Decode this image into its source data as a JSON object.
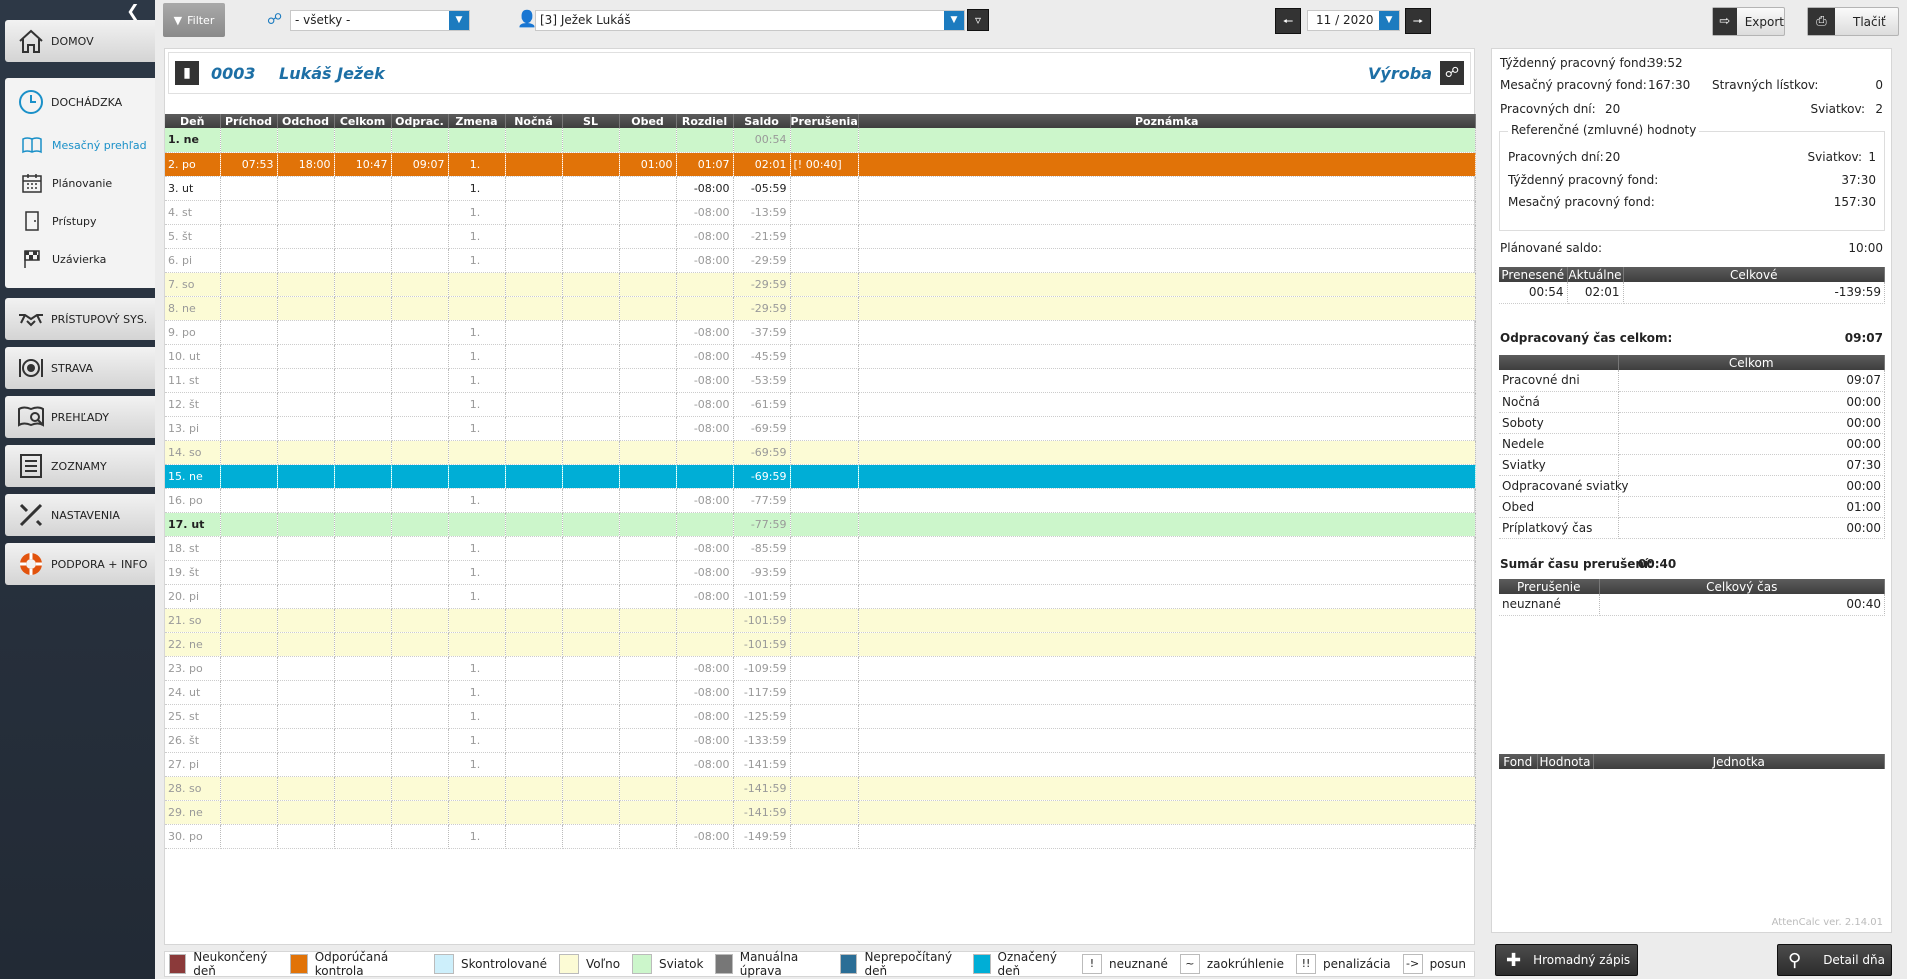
{
  "sidebar": {
    "items": [
      {
        "label": "DOMOV"
      },
      {
        "label": "DOCHÁDZKA"
      },
      {
        "label": "PRÍSTUPOVÝ SYS."
      },
      {
        "label": "STRAVA"
      },
      {
        "label": "PREHĽADY"
      },
      {
        "label": "ZOZNAMY"
      },
      {
        "label": "NASTAVENIA"
      },
      {
        "label": "PODPORA + INFO"
      }
    ],
    "sub": [
      {
        "label": "Mesačný prehľad"
      },
      {
        "label": "Plánovanie"
      },
      {
        "label": "Prístupy"
      },
      {
        "label": "Uzávierka"
      }
    ]
  },
  "toolbar": {
    "filter_label": "Filter",
    "group_value": "- všetky -",
    "employee_value": "[3] Ježek Lukáš",
    "month_value": "11 / 2020",
    "export_label": "Export",
    "print_label": "Tlačiť"
  },
  "employee": {
    "code": "0003",
    "name": "Lukáš Ježek",
    "department": "Výroba"
  },
  "table": {
    "headers": [
      "Deň",
      "Príchod",
      "Odchod",
      "Celkom",
      "Odprac.",
      "Zmena",
      "Nočná",
      "SL",
      "Obed",
      "Rozdiel",
      "Saldo",
      "Prerušenia",
      "Poznámka"
    ],
    "rows": [
      {
        "type": "hol",
        "day": "1. ne",
        "prichod": "",
        "odchod": "",
        "celkom": "",
        "odprac": "",
        "zmena": "",
        "nocna": "",
        "sl": "",
        "obed": "",
        "rozdiel": "",
        "saldo": "00:54",
        "prerusenia": "",
        "poznamka": ""
      },
      {
        "type": "ctrl",
        "day": "2. po",
        "prichod": "07:53",
        "odchod": "18:00",
        "celkom": "10:47",
        "odprac": "09:07",
        "zmena": "1.",
        "nocna": "",
        "sl": "",
        "obed": "01:00",
        "rozdiel": "01:07",
        "saldo": "02:01",
        "prerusenia": "[! 00:40]",
        "poznamka": ""
      },
      {
        "type": "today",
        "day": "3. ut",
        "prichod": "",
        "odchod": "",
        "celkom": "",
        "odprac": "",
        "zmena": "1.",
        "nocna": "",
        "sl": "",
        "obed": "",
        "rozdiel": "-08:00",
        "saldo": "-05:59",
        "prerusenia": "",
        "poznamka": ""
      },
      {
        "type": "",
        "day": "4. st",
        "prichod": "",
        "odchod": "",
        "celkom": "",
        "odprac": "",
        "zmena": "1.",
        "nocna": "",
        "sl": "",
        "obed": "",
        "rozdiel": "-08:00",
        "saldo": "-13:59",
        "prerusenia": "",
        "poznamka": ""
      },
      {
        "type": "",
        "day": "5. št",
        "prichod": "",
        "odchod": "",
        "celkom": "",
        "odprac": "",
        "zmena": "1.",
        "nocna": "",
        "sl": "",
        "obed": "",
        "rozdiel": "-08:00",
        "saldo": "-21:59",
        "prerusenia": "",
        "poznamka": ""
      },
      {
        "type": "",
        "day": "6. pi",
        "prichod": "",
        "odchod": "",
        "celkom": "",
        "odprac": "",
        "zmena": "1.",
        "nocna": "",
        "sl": "",
        "obed": "",
        "rozdiel": "-08:00",
        "saldo": "-29:59",
        "prerusenia": "",
        "poznamka": ""
      },
      {
        "type": "we",
        "day": "7. so",
        "prichod": "",
        "odchod": "",
        "celkom": "",
        "odprac": "",
        "zmena": "",
        "nocna": "",
        "sl": "",
        "obed": "",
        "rozdiel": "",
        "saldo": "-29:59",
        "prerusenia": "",
        "poznamka": ""
      },
      {
        "type": "we",
        "day": "8. ne",
        "prichod": "",
        "odchod": "",
        "celkom": "",
        "odprac": "",
        "zmena": "",
        "nocna": "",
        "sl": "",
        "obed": "",
        "rozdiel": "",
        "saldo": "-29:59",
        "prerusenia": "",
        "poznamka": ""
      },
      {
        "type": "",
        "day": "9. po",
        "prichod": "",
        "odchod": "",
        "celkom": "",
        "odprac": "",
        "zmena": "1.",
        "nocna": "",
        "sl": "",
        "obed": "",
        "rozdiel": "-08:00",
        "saldo": "-37:59",
        "prerusenia": "",
        "poznamka": ""
      },
      {
        "type": "",
        "day": "10. ut",
        "prichod": "",
        "odchod": "",
        "celkom": "",
        "odprac": "",
        "zmena": "1.",
        "nocna": "",
        "sl": "",
        "obed": "",
        "rozdiel": "-08:00",
        "saldo": "-45:59",
        "prerusenia": "",
        "poznamka": ""
      },
      {
        "type": "",
        "day": "11. st",
        "prichod": "",
        "odchod": "",
        "celkom": "",
        "odprac": "",
        "zmena": "1.",
        "nocna": "",
        "sl": "",
        "obed": "",
        "rozdiel": "-08:00",
        "saldo": "-53:59",
        "prerusenia": "",
        "poznamka": ""
      },
      {
        "type": "",
        "day": "12. št",
        "prichod": "",
        "odchod": "",
        "celkom": "",
        "odprac": "",
        "zmena": "1.",
        "nocna": "",
        "sl": "",
        "obed": "",
        "rozdiel": "-08:00",
        "saldo": "-61:59",
        "prerusenia": "",
        "poznamka": ""
      },
      {
        "type": "",
        "day": "13. pi",
        "prichod": "",
        "odchod": "",
        "celkom": "",
        "odprac": "",
        "zmena": "1.",
        "nocna": "",
        "sl": "",
        "obed": "",
        "rozdiel": "-08:00",
        "saldo": "-69:59",
        "prerusenia": "",
        "poznamka": ""
      },
      {
        "type": "we",
        "day": "14. so",
        "prichod": "",
        "odchod": "",
        "celkom": "",
        "odprac": "",
        "zmena": "",
        "nocna": "",
        "sl": "",
        "obed": "",
        "rozdiel": "",
        "saldo": "-69:59",
        "prerusenia": "",
        "poznamka": ""
      },
      {
        "type": "mark",
        "day": "15. ne",
        "prichod": "",
        "odchod": "",
        "celkom": "",
        "odprac": "",
        "zmena": "",
        "nocna": "",
        "sl": "",
        "obed": "",
        "rozdiel": "",
        "saldo": "-69:59",
        "prerusenia": "",
        "poznamka": ""
      },
      {
        "type": "",
        "day": "16. po",
        "prichod": "",
        "odchod": "",
        "celkom": "",
        "odprac": "",
        "zmena": "1.",
        "nocna": "",
        "sl": "",
        "obed": "",
        "rozdiel": "-08:00",
        "saldo": "-77:59",
        "prerusenia": "",
        "poznamka": ""
      },
      {
        "type": "hol",
        "day": "17. ut",
        "prichod": "",
        "odchod": "",
        "celkom": "",
        "odprac": "",
        "zmena": "",
        "nocna": "",
        "sl": "",
        "obed": "",
        "rozdiel": "",
        "saldo": "-77:59",
        "prerusenia": "",
        "poznamka": ""
      },
      {
        "type": "",
        "day": "18. st",
        "prichod": "",
        "odchod": "",
        "celkom": "",
        "odprac": "",
        "zmena": "1.",
        "nocna": "",
        "sl": "",
        "obed": "",
        "rozdiel": "-08:00",
        "saldo": "-85:59",
        "prerusenia": "",
        "poznamka": ""
      },
      {
        "type": "",
        "day": "19. št",
        "prichod": "",
        "odchod": "",
        "celkom": "",
        "odprac": "",
        "zmena": "1.",
        "nocna": "",
        "sl": "",
        "obed": "",
        "rozdiel": "-08:00",
        "saldo": "-93:59",
        "prerusenia": "",
        "poznamka": ""
      },
      {
        "type": "",
        "day": "20. pi",
        "prichod": "",
        "odchod": "",
        "celkom": "",
        "odprac": "",
        "zmena": "1.",
        "nocna": "",
        "sl": "",
        "obed": "",
        "rozdiel": "-08:00",
        "saldo": "-101:59",
        "prerusenia": "",
        "poznamka": ""
      },
      {
        "type": "we",
        "day": "21. so",
        "prichod": "",
        "odchod": "",
        "celkom": "",
        "odprac": "",
        "zmena": "",
        "nocna": "",
        "sl": "",
        "obed": "",
        "rozdiel": "",
        "saldo": "-101:59",
        "prerusenia": "",
        "poznamka": ""
      },
      {
        "type": "we",
        "day": "22. ne",
        "prichod": "",
        "odchod": "",
        "celkom": "",
        "odprac": "",
        "zmena": "",
        "nocna": "",
        "sl": "",
        "obed": "",
        "rozdiel": "",
        "saldo": "-101:59",
        "prerusenia": "",
        "poznamka": ""
      },
      {
        "type": "",
        "day": "23. po",
        "prichod": "",
        "odchod": "",
        "celkom": "",
        "odprac": "",
        "zmena": "1.",
        "nocna": "",
        "sl": "",
        "obed": "",
        "rozdiel": "-08:00",
        "saldo": "-109:59",
        "prerusenia": "",
        "poznamka": ""
      },
      {
        "type": "",
        "day": "24. ut",
        "prichod": "",
        "odchod": "",
        "celkom": "",
        "odprac": "",
        "zmena": "1.",
        "nocna": "",
        "sl": "",
        "obed": "",
        "rozdiel": "-08:00",
        "saldo": "-117:59",
        "prerusenia": "",
        "poznamka": ""
      },
      {
        "type": "",
        "day": "25. st",
        "prichod": "",
        "odchod": "",
        "celkom": "",
        "odprac": "",
        "zmena": "1.",
        "nocna": "",
        "sl": "",
        "obed": "",
        "rozdiel": "-08:00",
        "saldo": "-125:59",
        "prerusenia": "",
        "poznamka": ""
      },
      {
        "type": "",
        "day": "26. št",
        "prichod": "",
        "odchod": "",
        "celkom": "",
        "odprac": "",
        "zmena": "1.",
        "nocna": "",
        "sl": "",
        "obed": "",
        "rozdiel": "-08:00",
        "saldo": "-133:59",
        "prerusenia": "",
        "poznamka": ""
      },
      {
        "type": "",
        "day": "27. pi",
        "prichod": "",
        "odchod": "",
        "celkom": "",
        "odprac": "",
        "zmena": "1.",
        "nocna": "",
        "sl": "",
        "obed": "",
        "rozdiel": "-08:00",
        "saldo": "-141:59",
        "prerusenia": "",
        "poznamka": ""
      },
      {
        "type": "we",
        "day": "28. so",
        "prichod": "",
        "odchod": "",
        "celkom": "",
        "odprac": "",
        "zmena": "",
        "nocna": "",
        "sl": "",
        "obed": "",
        "rozdiel": "",
        "saldo": "-141:59",
        "prerusenia": "",
        "poznamka": ""
      },
      {
        "type": "we",
        "day": "29. ne",
        "prichod": "",
        "odchod": "",
        "celkom": "",
        "odprac": "",
        "zmena": "",
        "nocna": "",
        "sl": "",
        "obed": "",
        "rozdiel": "",
        "saldo": "-141:59",
        "prerusenia": "",
        "poznamka": ""
      },
      {
        "type": "",
        "day": "30. po",
        "prichod": "",
        "odchod": "",
        "celkom": "",
        "odprac": "",
        "zmena": "1.",
        "nocna": "",
        "sl": "",
        "obed": "",
        "rozdiel": "-08:00",
        "saldo": "-149:59",
        "prerusenia": "",
        "poznamka": ""
      }
    ]
  },
  "summary": {
    "weekly_fund_label": "Týždenný pracovný fond:",
    "weekly_fund": "39:52",
    "monthly_fund_label": "Mesačný pracovný fond:",
    "monthly_fund": "167:30",
    "meal_label": "Stravných lístkov:",
    "meal": "0",
    "workdays_label": "Pracovných dní:",
    "workdays": "20",
    "holidays_label": "Sviatkov:",
    "holidays": "2",
    "ref": {
      "title": "Referenčné (zmluvné) hodnoty",
      "workdays_label": "Pracovných dní:",
      "workdays": "20",
      "holidays_label": "Sviatkov:",
      "holidays": "1",
      "weekly_label": "Týždenný pracovný fond:",
      "weekly": "37:30",
      "monthly_label": "Mesačný pracovný fond:",
      "monthly": "157:30"
    },
    "planned_label": "Plánované saldo:",
    "planned": "10:00",
    "saldo_headers": [
      "Prenesené",
      "Aktuálne",
      "Celkové"
    ],
    "saldo_values": [
      "00:54",
      "02:01",
      "-139:59"
    ],
    "worked_label": "Odpracovaný čas celkom:",
    "worked": "09:07",
    "worked_header": "Celkom",
    "worked_rows": [
      {
        "label": "Pracovné dni",
        "value": "09:07"
      },
      {
        "label": "Nočná",
        "value": "00:00"
      },
      {
        "label": "Soboty",
        "value": "00:00"
      },
      {
        "label": "Nedele",
        "value": "00:00"
      },
      {
        "label": "Sviatky",
        "value": "07:30"
      },
      {
        "label": "Odpracované sviatky",
        "value": "00:00"
      },
      {
        "label": "Obed",
        "value": "01:00"
      },
      {
        "label": "Príplatkový čas",
        "value": "00:00"
      }
    ],
    "break_label": "Sumár času prerušení:",
    "break": "00:40",
    "break_headers": [
      "Prerušenie",
      "Celkový čas"
    ],
    "break_rows": [
      {
        "label": "neuznané",
        "value": "00:40"
      }
    ],
    "fund_headers": [
      "Fond",
      "Hodnota",
      "Jednotka"
    ],
    "version": "AttenCalc ver. 2.14.01"
  },
  "legend": [
    {
      "label": "Neukončený deň",
      "color": "#8b3a3a",
      "mark": ""
    },
    {
      "label": "Odporúčaná kontrola",
      "color": "#e17308",
      "mark": ""
    },
    {
      "label": "Skontrolované",
      "color": "#cdeffb",
      "mark": ""
    },
    {
      "label": "Voľno",
      "color": "#fcfbd5",
      "mark": ""
    },
    {
      "label": "Sviatok",
      "color": "#ccf6cb",
      "mark": ""
    },
    {
      "label": "Manuálna úprava",
      "color": "#777777",
      "mark": ""
    },
    {
      "label": "Neprepočítaný deň",
      "color": "#2b6e96",
      "mark": ""
    },
    {
      "label": "Označený deň",
      "color": "#00aed6",
      "mark": ""
    },
    {
      "label": "neuznané",
      "color": "#ffffff",
      "mark": "!"
    },
    {
      "label": "zaokrúhlenie",
      "color": "#ffffff",
      "mark": "~"
    },
    {
      "label": "penalizácia",
      "color": "#ffffff",
      "mark": "!!"
    },
    {
      "label": "posun",
      "color": "#ffffff",
      "mark": "->"
    }
  ],
  "footer": {
    "bulk_label": "Hromadný zápis",
    "detail_label": "Detail dňa"
  }
}
